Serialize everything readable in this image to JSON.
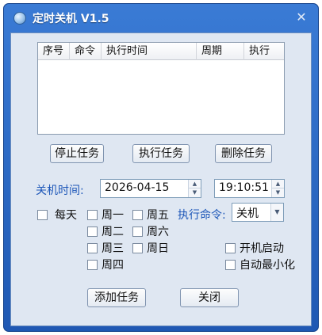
{
  "window": {
    "title": "定时关机 V1.5",
    "close_glyph": "✕"
  },
  "task_list": {
    "columns": [
      "序号",
      "命令",
      "执行时间",
      "周期",
      "执行"
    ]
  },
  "buttons": {
    "stop_task": "停止任务",
    "run_task": "执行任务",
    "delete_task": "删除任务",
    "add_task": "添加任务",
    "close": "关闭"
  },
  "shutdown": {
    "label": "关机时间:",
    "date": "2026-04-15",
    "time": "19:10:51"
  },
  "schedule": {
    "everyday": "每天",
    "days": [
      "周一",
      "周二",
      "周三",
      "周四",
      "周五",
      "周六",
      "周日"
    ]
  },
  "command": {
    "label": "执行命令:",
    "selected": "关机"
  },
  "options": {
    "startup": "开机启动",
    "auto_minimize": "自动最小化"
  },
  "colors": {
    "title_bar": "#2a66c4",
    "label_accent": "#1c56b8",
    "client_bg": "#dfe7f2"
  }
}
